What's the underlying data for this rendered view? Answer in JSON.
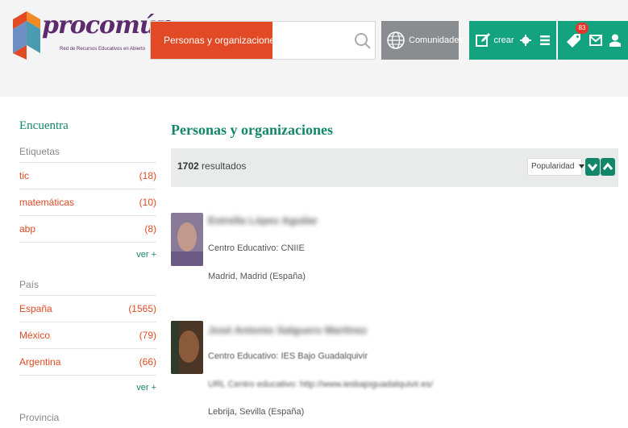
{
  "header": {
    "logo_text": "procomún",
    "logo_subtitle": "Red de Recursos Educativos en Abierto",
    "search_category": "Personas y organizaciones",
    "search_category_arrow": "»",
    "search_placeholder": "",
    "communities_label": "Comunidades",
    "create_label": "crear",
    "notifications_count": "83"
  },
  "sidebar": {
    "title": "Encuentra",
    "sections": [
      {
        "label": "Etiquetas",
        "items": [
          {
            "label": "tic",
            "count": "(18)"
          },
          {
            "label": "matemáticas",
            "count": "(10)"
          },
          {
            "label": "abp",
            "count": "(8)"
          }
        ],
        "more": "ver +"
      },
      {
        "label": "País",
        "items": [
          {
            "label": "España",
            "count": "(1565)"
          },
          {
            "label": "México",
            "count": "(79)"
          },
          {
            "label": "Argentina",
            "count": "(66)"
          }
        ],
        "more": "ver +"
      },
      {
        "label": "Provincia"
      }
    ]
  },
  "main": {
    "title": "Personas y organizaciones",
    "results_count": "1702",
    "results_label": "resultados",
    "sort_value": "Popularidad",
    "people": [
      {
        "name": "Estrella López Aguilar",
        "center": "Centro Educativo: CNIIE",
        "location": "Madrid, Madrid (España)"
      },
      {
        "name": "José Antonio Salguero Martínez",
        "center": "Centro Educativo: IES Bajo Guadalquivir",
        "url": "URL Centro educativo: http://www.iesbajoguadalquivir.es/",
        "location": "Lebrija, Sevilla (España)"
      }
    ]
  },
  "colors": {
    "brand_green": "#13866a",
    "toolbar_green": "#14a37f",
    "accent_orange": "#e14a24",
    "logo_purple": "#5b2b6e"
  }
}
